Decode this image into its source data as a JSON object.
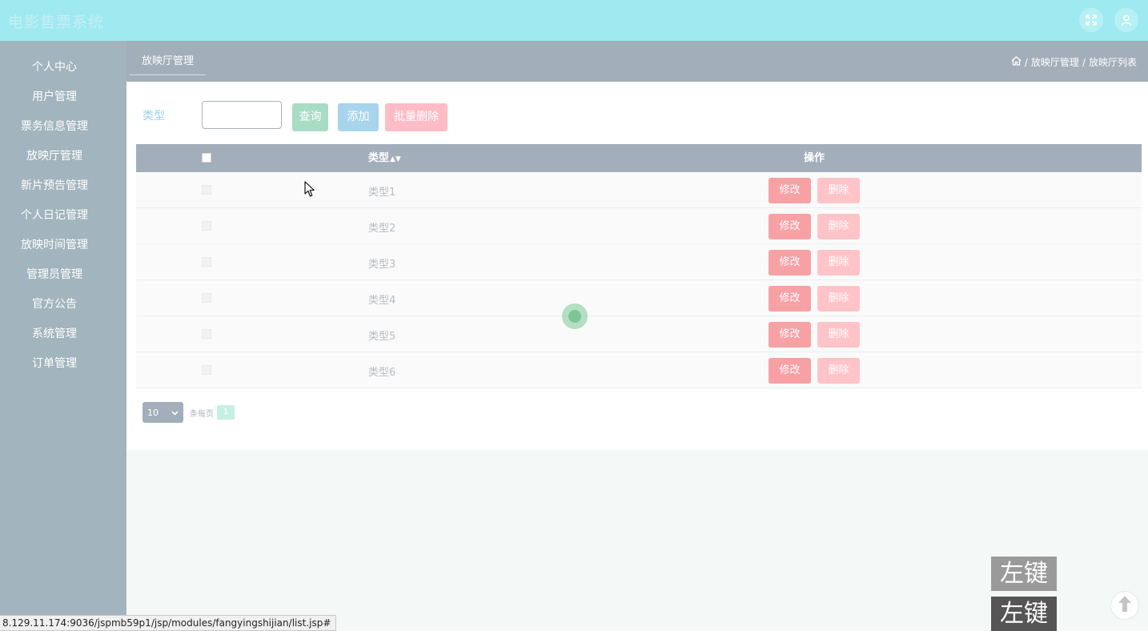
{
  "app": {
    "title": "电影售票系统"
  },
  "header_icons": [
    "fullscreen-icon",
    "user-icon"
  ],
  "sidebar": {
    "items": [
      {
        "label": "个人中心"
      },
      {
        "label": "用户管理"
      },
      {
        "label": "票务信息管理"
      },
      {
        "label": "放映厅管理"
      },
      {
        "label": "新片预告管理"
      },
      {
        "label": "个人日记管理"
      },
      {
        "label": "放映时间管理"
      },
      {
        "label": "管理员管理"
      },
      {
        "label": "官方公告"
      },
      {
        "label": "系统管理"
      },
      {
        "label": "订单管理"
      }
    ]
  },
  "page": {
    "title": "放映厅管理",
    "breadcrumb": [
      "放映厅管理",
      "放映厅列表"
    ],
    "breadcrumb_separator": "/"
  },
  "search": {
    "label": "类型",
    "value": "",
    "placeholder": "",
    "query_label": "查询",
    "add_label": "添加",
    "batch_delete_label": "批量删除"
  },
  "table": {
    "columns": [
      "类型",
      "操作"
    ],
    "sort_icon": "sort-icon",
    "rows": [
      {
        "type": "类型1",
        "edit": "修改",
        "delete": "删除"
      },
      {
        "type": "类型2",
        "edit": "修改",
        "delete": "删除"
      },
      {
        "type": "类型3",
        "edit": "修改",
        "delete": "删除"
      },
      {
        "type": "类型4",
        "edit": "修改",
        "delete": "删除"
      },
      {
        "type": "类型5",
        "edit": "修改",
        "delete": "删除"
      },
      {
        "type": "类型6",
        "edit": "修改",
        "delete": "删除"
      }
    ]
  },
  "pagination": {
    "page_size": "10",
    "per_page_label": "条每页",
    "current_page": "1"
  },
  "status_bar": {
    "url": "8.129.11.174:9036/jspmb59p1/jsp/modules/fangyingshijian/list.jsp#"
  },
  "overlay": {
    "hint_top": "左键",
    "hint_bottom": "左键"
  },
  "colors": {
    "topbar": "#9eeaf0",
    "sidebar": "#a2b4bd",
    "header_bar": "#a2aeb9",
    "query_button": "#a8dcc4",
    "add_button": "#a8d4ec",
    "batch_delete_button": "#ffbcc6",
    "edit_button": "#f7a1a5",
    "delete_button": "#ffc3c8"
  }
}
